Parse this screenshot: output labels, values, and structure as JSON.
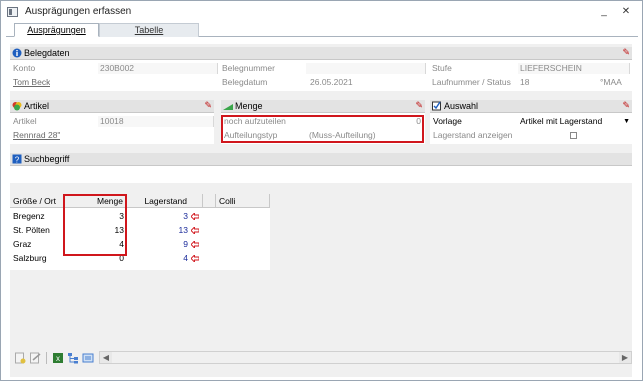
{
  "window": {
    "title": "Ausprägungen erfassen",
    "minimize": "_",
    "close": "✕"
  },
  "tabs": [
    {
      "label": "Ausprägungen"
    },
    {
      "label": "Tabelle"
    }
  ],
  "belegdaten": {
    "header": "Belegdaten",
    "rows": [
      {
        "label": "Konto",
        "value": "230B002",
        "label2": "Belegnummer",
        "value2": "",
        "label3": "Stufe",
        "value3": "LIEFERSCHEIN"
      },
      {
        "label": "Tom Beck",
        "value": "",
        "label2": "Belegdatum",
        "value2": "26.05.2021",
        "label3": "Laufnummer / Status",
        "value3": "18",
        "value3b": "°MAA"
      }
    ]
  },
  "artikel": {
    "header": "Artikel",
    "rows": [
      {
        "label": "Artikel",
        "value": "10018"
      },
      {
        "label": "Rennrad 28\"",
        "value": ""
      }
    ]
  },
  "menge": {
    "header": "Menge",
    "rows": [
      {
        "label": "noch aufzuteilen",
        "value": "0"
      },
      {
        "label": "Aufteilungstyp",
        "value": "(Muss-Aufteilung)"
      }
    ]
  },
  "auswahl": {
    "header": "Auswahl",
    "rows": [
      {
        "label": "Vorlage",
        "value": "Artikel mit Lagerstand"
      },
      {
        "label": "Lagerstand anzeigen",
        "value": ""
      }
    ]
  },
  "suchbegriff": {
    "header": "Suchbegriff"
  },
  "grid": {
    "headers": [
      "Größe / Ort",
      "Menge",
      "Lagerstand",
      "Colli"
    ],
    "rows": [
      {
        "ort": "Bregenz",
        "menge": "3",
        "lager": "3"
      },
      {
        "ort": "St. Pölten",
        "menge": "13",
        "lager": "13"
      },
      {
        "ort": "Graz",
        "menge": "4",
        "lager": "9"
      },
      {
        "ort": "Salzburg",
        "menge": "0",
        "lager": "4"
      }
    ]
  },
  "colors": {
    "highlight": "#d0161c",
    "accent_red": "#c01010"
  }
}
